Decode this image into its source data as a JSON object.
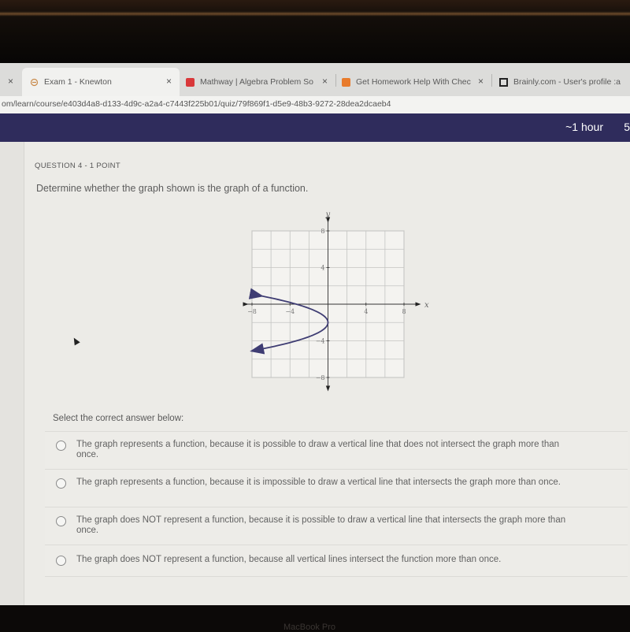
{
  "browser": {
    "tabs": [
      {
        "title": "",
        "close": "×"
      },
      {
        "title": "Exam 1 - Knewton",
        "close": "×",
        "active": true,
        "favicon": "knewton-icon"
      },
      {
        "title": "Mathway | Algebra Problem So",
        "close": "×",
        "favicon": "mathway-icon",
        "favicon_color": "#d9383a"
      },
      {
        "title": "Get Homework Help With Chec",
        "close": "×",
        "favicon": "chegg-icon",
        "favicon_color": "#e87b2c"
      },
      {
        "title": "Brainly.com - User's profile :a",
        "favicon": "brainly-icon"
      }
    ],
    "address": "om/learn/course/e403d4a8-d133-4d9c-a2a4-c7443f225b01/quiz/79f869f1-d5e9-48b3-9272-28dea2dcaeb4"
  },
  "header": {
    "timer": "~1 hour",
    "timer_extra": "5",
    "bg_color": "#2f2c5c"
  },
  "question": {
    "label": "QUESTION 4 - 1 POINT",
    "text": "Determine whether the graph shown is the graph of a function."
  },
  "chart_data": {
    "type": "line",
    "title": "",
    "xlabel": "x",
    "ylabel": "y",
    "xlim": [
      -8,
      8
    ],
    "ylim": [
      -8,
      8
    ],
    "grid": true,
    "grid_step": 2,
    "x_ticks": [
      "-8",
      "-4",
      "4",
      "8"
    ],
    "y_ticks": [
      "8",
      "4",
      "-4",
      "-8"
    ],
    "curve": {
      "description": "sideways parabola opening left, vertex at (0,-2), arrows at both ends",
      "equation": "x = -(y+2)^2 * 7.5/9",
      "points": [
        [
          -7.5,
          1
        ],
        [
          -4,
          -0.2
        ],
        [
          -2,
          -0.7
        ],
        [
          0,
          -2
        ],
        [
          -2,
          -3.3
        ],
        [
          -4,
          -4
        ],
        [
          -7.5,
          -5
        ]
      ],
      "color": "#3f3d73"
    }
  },
  "answers": {
    "prompt": "Select the correct answer below:",
    "options": [
      "The graph represents a function, because it is possible to draw a vertical line that does not intersect the graph more than once.",
      "The graph represents a function, because it is impossible to draw a vertical line that  intersects the graph more than once.",
      "The graph does NOT represent a function, because it is possible to draw a vertical line that intersects the graph more than once.",
      "The graph does NOT represent a function, because all vertical lines intersect the function more than once."
    ]
  },
  "device": {
    "brand": "MacBook Pro"
  }
}
